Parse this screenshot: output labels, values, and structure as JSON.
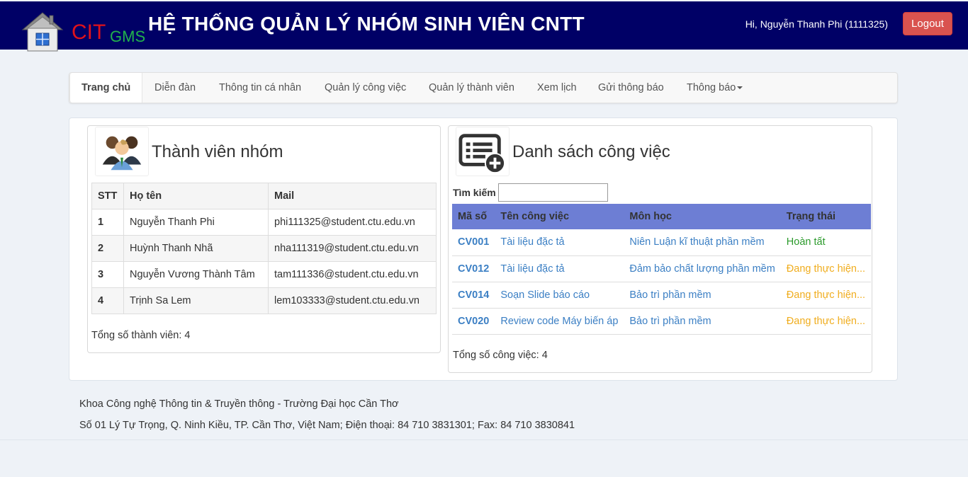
{
  "header": {
    "logo_cit": "CIT",
    "logo_gms": "GMS",
    "title": "HỆ THỐNG QUẢN LÝ NHÓM SINH VIÊN CNTT",
    "greeting": "Hi, Nguyễn Thanh Phi (1111325)",
    "logout_label": "Logout"
  },
  "nav": {
    "items": [
      {
        "label": "Trang chủ",
        "active": true
      },
      {
        "label": "Diễn đàn"
      },
      {
        "label": "Thông tin cá nhân"
      },
      {
        "label": "Quản lý công việc"
      },
      {
        "label": "Quản lý thành viên"
      },
      {
        "label": "Xem lịch"
      },
      {
        "label": "Gửi thông báo"
      },
      {
        "label": "Thông báo",
        "dropdown": true
      }
    ]
  },
  "members": {
    "title": "Thành viên nhóm",
    "icon": "group-people-icon",
    "columns": [
      "STT",
      "Họ tên",
      "Mail"
    ],
    "rows": [
      [
        "1",
        "Nguyễn Thanh Phi",
        "phi111325@student.ctu.edu.vn"
      ],
      [
        "2",
        "Huỳnh Thanh Nhã",
        "nha111319@student.ctu.edu.vn"
      ],
      [
        "3",
        "Nguyễn Vương Thành Tâm",
        "tam111336@student.ctu.edu.vn"
      ],
      [
        "4",
        "Trịnh Sa Lem",
        "lem103333@student.ctu.edu.vn"
      ]
    ],
    "total": "Tổng số thành viên: 4"
  },
  "tasks": {
    "title": "Danh sách công việc",
    "icon": "task-list-add-icon",
    "search_label": "Tìm kiếm",
    "search_value": "",
    "columns": [
      "Mã số",
      "Tên công việc",
      "Môn học",
      "Trạng thái"
    ],
    "rows": [
      [
        "CV001",
        "Tài liệu đặc tả",
        "Niên Luận kĩ thuật phần mềm",
        "Hoàn tất"
      ],
      [
        "CV012",
        "Tài liệu đặc tả",
        "Đảm bảo chất lượng phần mềm",
        "Đang thực hiện..."
      ],
      [
        "CV014",
        "Soạn Slide báo cáo",
        "Bảo trì phần mềm",
        "Đang thực hiện..."
      ],
      [
        "CV020",
        "Review code Máy biến áp",
        "Bảo trì phần mềm",
        "Đang thực hiện..."
      ]
    ],
    "total": "Tổng số công việc: 4"
  },
  "footer": {
    "line1": "Khoa Công nghệ Thông tin & Truyền thông - Trường Đại học Cần Thơ",
    "line2": "Số 01 Lý Tự Trọng, Q. Ninh Kiều, TP. Cần Thơ, Việt Nam; Điện thoại: 84 710 3831301; Fax: 84 710 3830841"
  },
  "colors": {
    "header_bg": "#000066",
    "logout_bg": "#d9534f",
    "table_header_bg": "#6d7ed4",
    "link": "#3b7fc4",
    "status_done": "#2b9a2b",
    "status_progress": "#f0ad1e"
  }
}
